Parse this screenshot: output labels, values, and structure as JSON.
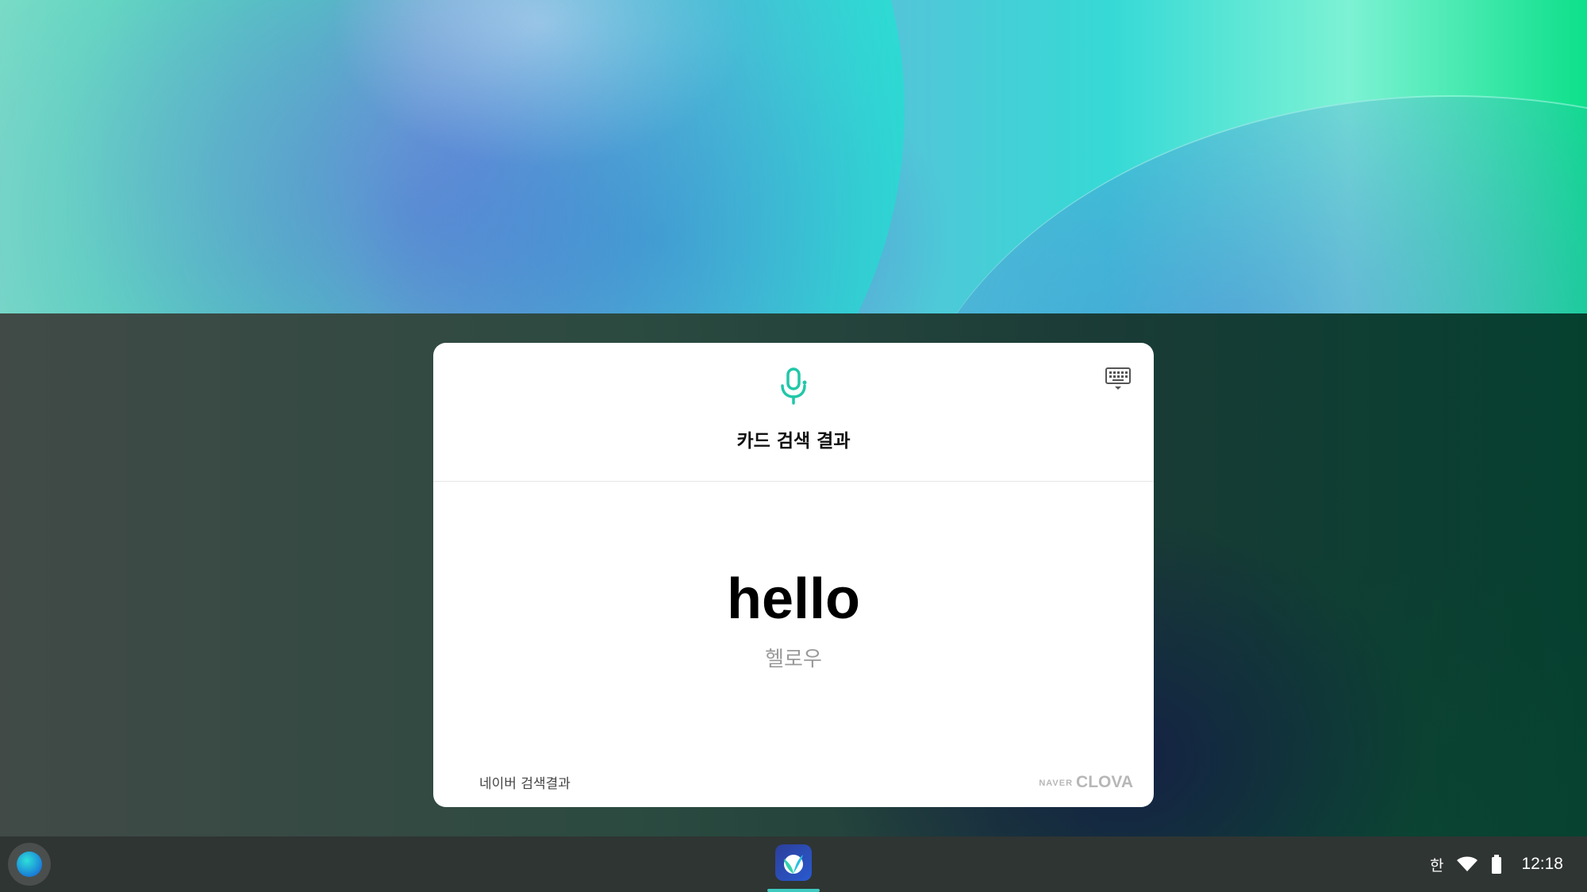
{
  "card": {
    "title": "카드 검색 결과",
    "word": "hello",
    "reading": "헬로우",
    "footer_link": "네이버 검색결과",
    "brand_naver": "NAVER",
    "brand_clova": "CLOVA"
  },
  "tray": {
    "ime": "한",
    "time": "12:18"
  },
  "colors": {
    "accent": "#21c7a8",
    "shelf": "#2f3533",
    "card_bg": "#ffffff"
  },
  "icons": [
    "microphone-icon",
    "keyboard-icon",
    "launcher-icon",
    "clova-app-icon",
    "wifi-icon",
    "battery-icon"
  ]
}
